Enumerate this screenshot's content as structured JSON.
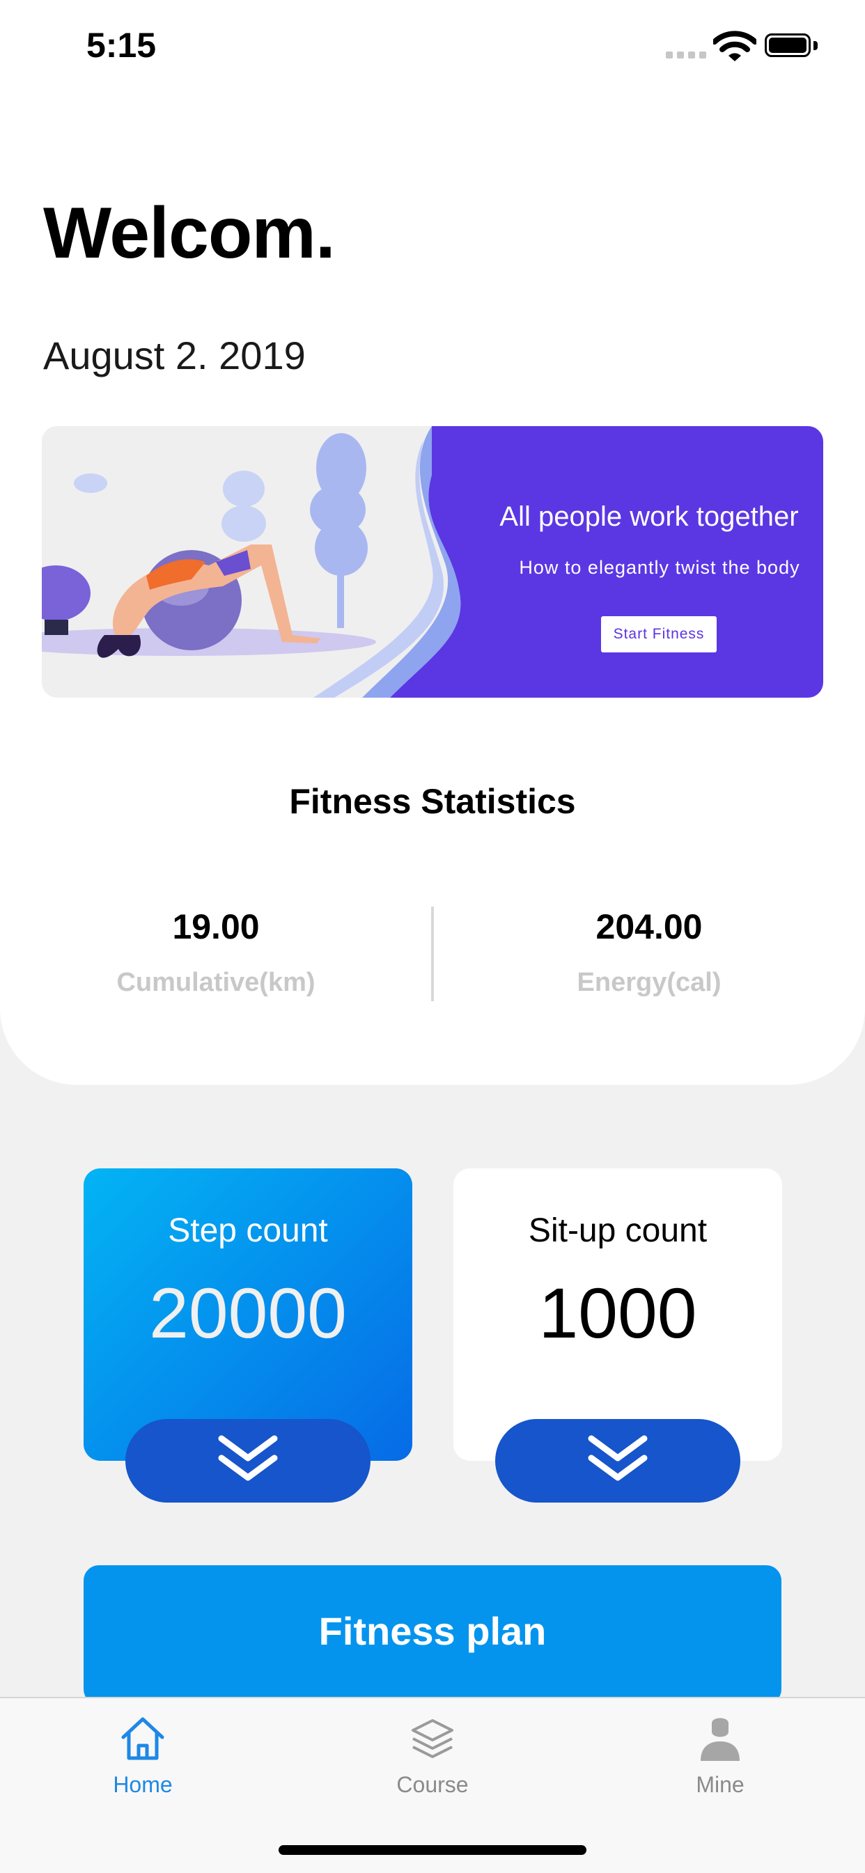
{
  "status_bar": {
    "time": "5:15"
  },
  "header": {
    "title": "Welcom.",
    "date": "August 2. 2019"
  },
  "banner": {
    "title": "All people work together",
    "subtitle": "How to elegantly twist the body",
    "button_label": "Start Fitness"
  },
  "statistics": {
    "title": "Fitness Statistics",
    "items": [
      {
        "value": "19.00",
        "label": "Cumulative(km)"
      },
      {
        "value": "204.00",
        "label": "Energy(cal)"
      }
    ]
  },
  "metrics": [
    {
      "label": "Step count",
      "value": "20000"
    },
    {
      "label": "Sit-up count",
      "value": "1000"
    }
  ],
  "plan_button": {
    "label": "Fitness plan"
  },
  "tab_bar": {
    "items": [
      {
        "label": "Home",
        "icon": "home-icon",
        "active": true
      },
      {
        "label": "Course",
        "icon": "layers-icon",
        "active": false
      },
      {
        "label": "Mine",
        "icon": "person-icon",
        "active": false
      }
    ]
  },
  "colors": {
    "accent": "#0494ee",
    "banner_purple": "#5b37e3",
    "expand_button": "#1655cb",
    "tab_active": "#1e88e5"
  }
}
